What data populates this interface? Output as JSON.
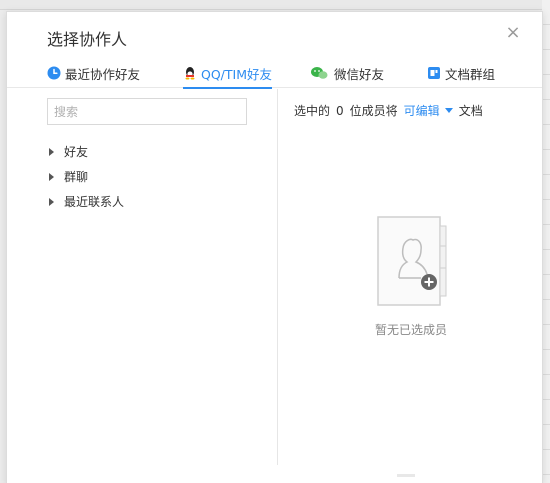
{
  "dialog": {
    "title": "选择协作人",
    "close_label": "×"
  },
  "tabs": [
    {
      "label": "最近协作好友",
      "icon": "clock-icon",
      "active": false
    },
    {
      "label": "QQ/TIM好友",
      "icon": "qq-icon",
      "active": true
    },
    {
      "label": "微信好友",
      "icon": "wechat-icon",
      "active": false
    },
    {
      "label": "文档群组",
      "icon": "doc-group-icon",
      "active": false
    }
  ],
  "left": {
    "search_placeholder": "搜索",
    "tree": [
      {
        "label": "好友"
      },
      {
        "label": "群聊"
      },
      {
        "label": "最近联系人"
      }
    ]
  },
  "right": {
    "summary_prefix": "选中的",
    "selected_count": "0",
    "summary_middle": "位成员将",
    "permission": "可编辑",
    "summary_suffix": "文档",
    "empty_text": "暂无已选成员"
  },
  "colors": {
    "accent": "#2d8cf0",
    "text": "#333333",
    "muted": "#888888"
  }
}
